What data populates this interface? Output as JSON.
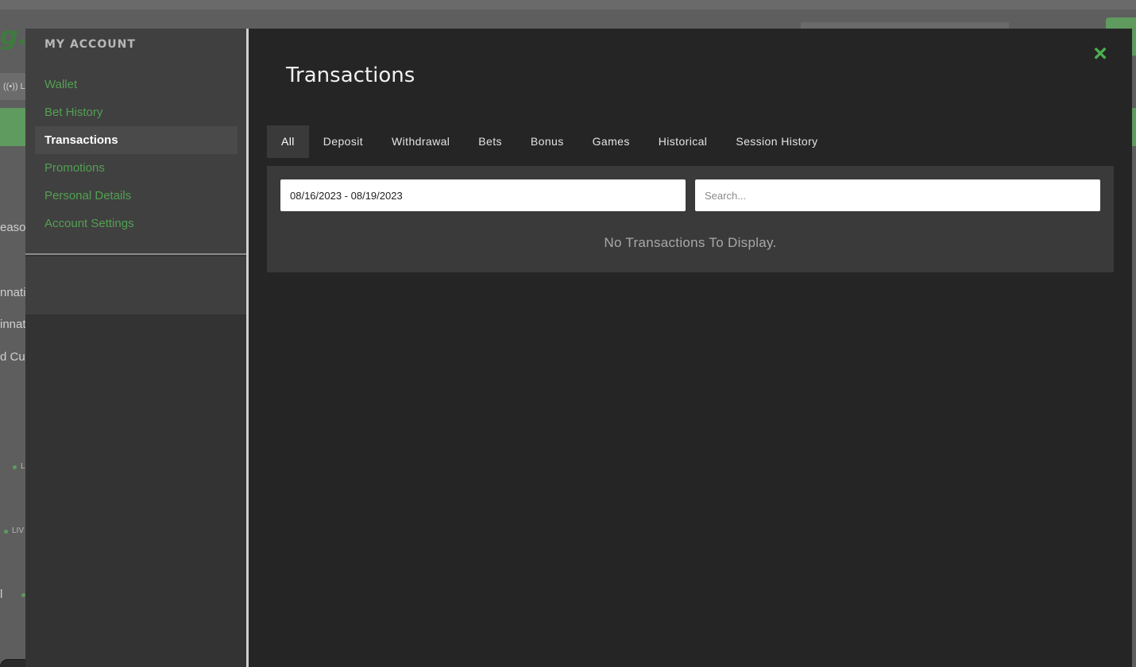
{
  "background": {
    "logo_text": "g.",
    "subnav_text": "((•)) L",
    "side_texts": [
      "easor",
      "nnati",
      "innat",
      "d Cu",
      "l"
    ],
    "live_labels": [
      "L",
      "LIV"
    ]
  },
  "modal": {
    "close_icon": "×",
    "sidebar": {
      "heading": "MY ACCOUNT",
      "items": [
        {
          "label": "Wallet",
          "active": false
        },
        {
          "label": "Bet History",
          "active": false
        },
        {
          "label": "Transactions",
          "active": true
        },
        {
          "label": "Promotions",
          "active": false
        },
        {
          "label": "Personal Details",
          "active": false
        },
        {
          "label": "Account Settings",
          "active": false
        }
      ]
    },
    "title": "Transactions",
    "tabs": [
      {
        "label": "All",
        "active": true
      },
      {
        "label": "Deposit",
        "active": false
      },
      {
        "label": "Withdrawal",
        "active": false
      },
      {
        "label": "Bets",
        "active": false
      },
      {
        "label": "Bonus",
        "active": false
      },
      {
        "label": "Games",
        "active": false
      },
      {
        "label": "Historical",
        "active": false
      },
      {
        "label": "Session History",
        "active": false
      }
    ],
    "filters": {
      "date_range_value": "08/16/2023 - 08/19/2023",
      "search_placeholder": "Search..."
    },
    "empty_message": "No Transactions To Display."
  },
  "colors": {
    "accent_green": "#4caf50",
    "menu_link_green": "#52a052",
    "modal_bg": "#252525",
    "panel_bg": "#3a3a3a"
  }
}
